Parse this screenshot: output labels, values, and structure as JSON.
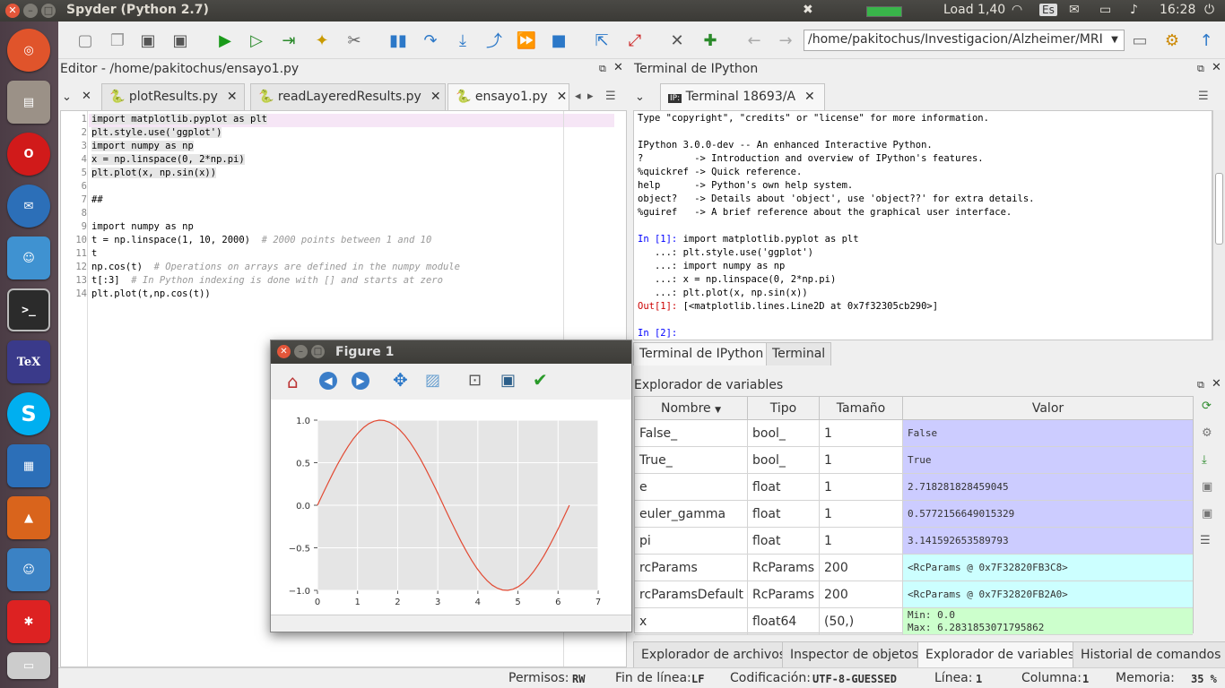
{
  "window": {
    "title": "Spyder (Python 2.7)"
  },
  "tray": {
    "load": "Load 1,40",
    "keyboard": "Es",
    "time": "16:28"
  },
  "launcher": {
    "items": [
      "Ubuntu",
      "Files",
      "Opera",
      "Thunderbird",
      "Android",
      "Terminal",
      "TeX",
      "Skype",
      "Apps",
      "Matlab",
      "Chat",
      "Web"
    ]
  },
  "toolbar": {
    "path": "/home/pakitochus/Investigacion/Alzheimer/MRI"
  },
  "editor": {
    "title": "Editor - /home/pakitochus/ensayo1.py",
    "tabs": [
      "plotResults.py",
      "readLayeredResults.py",
      "ensayo1.py"
    ],
    "line_numbers": [
      "1",
      "2",
      "3",
      "4",
      "5",
      "6",
      "7",
      "8",
      "9",
      "10",
      "11",
      "12",
      "13",
      "14"
    ],
    "lines": [
      "import matplotlib.pyplot as plt",
      "plt.style.use('ggplot')",
      "import numpy as np",
      "x = np.linspace(0, 2*np.pi)",
      "plt.plot(x, np.sin(x))",
      "",
      "##",
      "",
      "import numpy as np",
      "t = np.linspace(1, 10, 2000)",
      "t",
      "np.cos(t)",
      "t[:3]",
      "plt.plot(t,np.cos(t))"
    ],
    "comments": {
      "10": "# 2000 points between 1 and 10",
      "12": "# Operations on arrays are defined in the numpy module",
      "13": "# In Python indexing is done with [] and starts at zero"
    }
  },
  "terminal": {
    "title": "Terminal de IPython",
    "tab": "Terminal 18693/A",
    "lines": [
      "Type \"copyright\", \"credits\" or \"license\" for more information.",
      "",
      "IPython 3.0.0-dev -- An enhanced Interactive Python.",
      "?         -> Introduction and overview of IPython's features.",
      "%quickref -> Quick reference.",
      "help      -> Python's own help system.",
      "object?   -> Details about 'object', use 'object??' for extra details.",
      "%guiref   -> A brief reference about the graphical user interface."
    ],
    "in1_prompt": "In [1]:",
    "in1": [
      "import matplotlib.pyplot as plt",
      "plt.style.use('ggplot')",
      "import numpy as np",
      "x = np.linspace(0, 2*np.pi)",
      "plt.plot(x, np.sin(x))"
    ],
    "cont_prompt": "   ...:",
    "out1_prompt": "Out[1]:",
    "out1": "[<matplotlib.lines.Line2D at 0x7f32305cb290>]",
    "in2_prompt": "In [2]:",
    "bottom_tabs": [
      "Terminal de IPython",
      "Terminal"
    ]
  },
  "varexp": {
    "title": "Explorador de variables",
    "headers": [
      "Nombre",
      "Tipo",
      "Tamaño",
      "Valor"
    ],
    "rows": [
      {
        "name": "False_",
        "type": "bool_",
        "size": "1",
        "value": "False",
        "color": "#ccccff"
      },
      {
        "name": "True_",
        "type": "bool_",
        "size": "1",
        "value": "True",
        "color": "#ccccff"
      },
      {
        "name": "e",
        "type": "float",
        "size": "1",
        "value": "2.718281828459045",
        "color": "#ccccff"
      },
      {
        "name": "euler_gamma",
        "type": "float",
        "size": "1",
        "value": "0.5772156649015329",
        "color": "#ccccff"
      },
      {
        "name": "pi",
        "type": "float",
        "size": "1",
        "value": "3.141592653589793",
        "color": "#ccccff"
      },
      {
        "name": "rcParams",
        "type": "RcParams",
        "size": "200",
        "value": "<RcParams @ 0x7F32820FB3C8>",
        "color": "#ccffff"
      },
      {
        "name": "rcParamsDefault",
        "type": "RcParams",
        "size": "200",
        "value": "<RcParams @ 0x7F32820FB2A0>",
        "color": "#ccffff"
      },
      {
        "name": "x",
        "type": "float64",
        "size": "(50,)",
        "value": "Min: 0.0",
        "value2": "Max: 6.2831853071795862",
        "color": "#ccffcc"
      }
    ],
    "bottom_tabs": [
      "Explorador de archivos",
      "Inspector de objetos",
      "Explorador de variables",
      "Historial de comandos"
    ]
  },
  "figure": {
    "title": "Figure 1"
  },
  "chart_data": {
    "type": "line",
    "title": "",
    "xlabel": "",
    "ylabel": "",
    "xlim": [
      0,
      7
    ],
    "ylim": [
      -1.0,
      1.0
    ],
    "xticks": [
      "0",
      "1",
      "2",
      "3",
      "4",
      "5",
      "6",
      "7"
    ],
    "yticks": [
      "1.0",
      "0.5",
      "0.0",
      "−0.5",
      "−1.0"
    ],
    "series": [
      {
        "function": "sin(x)",
        "x_range": [
          0,
          6.2832
        ],
        "points": 50,
        "color": "#e24a33"
      }
    ],
    "style": "ggplot",
    "grid": true
  },
  "status": {
    "permisos_label": "Permisos:",
    "permisos": "RW",
    "eol_label": "Fin de línea:",
    "eol": "LF",
    "enc_label": "Codificación:",
    "enc": "UTF-8-GUESSED",
    "line_label": "Línea:",
    "line": "1",
    "col_label": "Columna:",
    "col": "1",
    "mem_label": "Memoria:",
    "mem": "35 %"
  }
}
